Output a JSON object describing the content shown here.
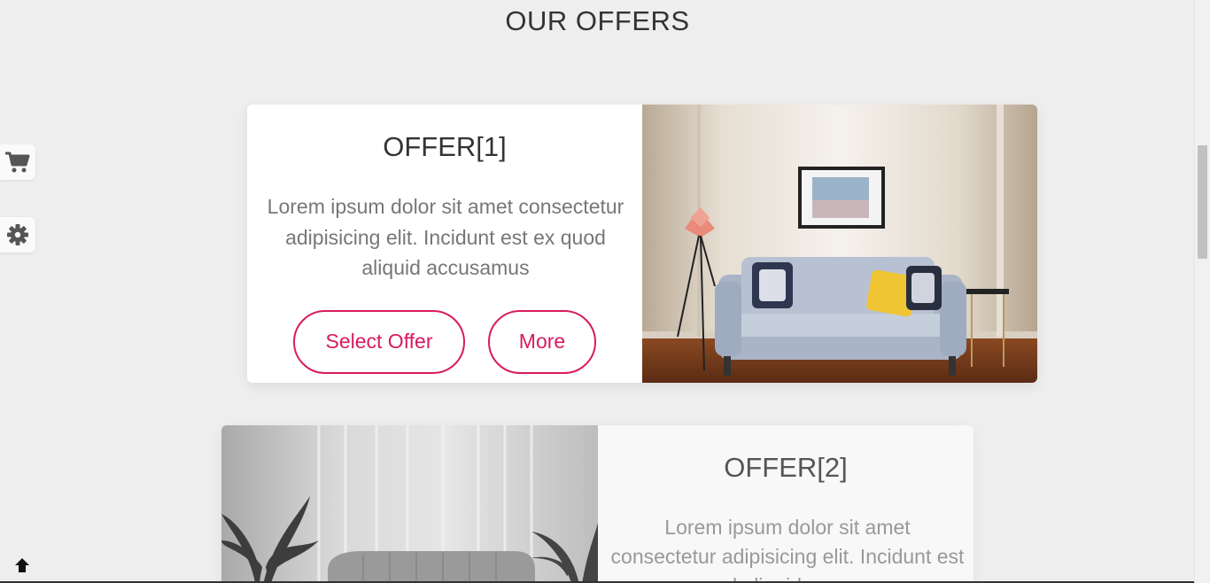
{
  "section": {
    "title": "OUR OFFERS"
  },
  "side_widgets": {
    "cart_icon": "shopping-cart-icon",
    "settings_icon": "gear-icon"
  },
  "scroll_top_icon": "arrow-up-icon",
  "offers": [
    {
      "title": "OFFER[1]",
      "description": "Lorem ipsum dolor sit amet consectetur adipisicing elit. Incidunt est ex quod aliquid accusamus",
      "select_label": "Select Offer",
      "more_label": "More",
      "image": "living-room-sofa-photo"
    },
    {
      "title": "OFFER[2]",
      "description": "Lorem ipsum dolor sit amet consectetur adipisicing elit. Incidunt est ex quod aliquid accusamus",
      "image": "grayscale-armchair-room-photo"
    }
  ],
  "colors": {
    "accent": "#d81b60",
    "background": "#eeeeee",
    "card": "#ffffff"
  }
}
